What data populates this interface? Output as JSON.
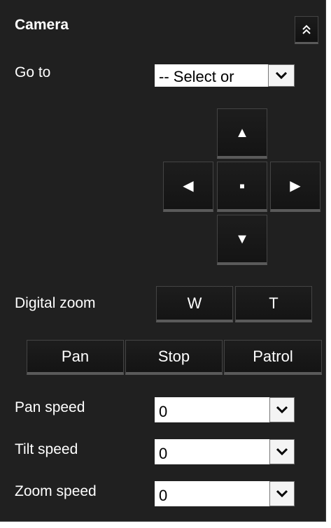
{
  "panel": {
    "title": "Camera",
    "collapse_icon": "double-chevron-up-icon"
  },
  "goto": {
    "label": "Go to",
    "selected": "-- Select or"
  },
  "dpad": {
    "up": "▲",
    "left": "◀",
    "home": "■",
    "right": "▶",
    "down": "▼"
  },
  "digital_zoom": {
    "label": "Digital zoom",
    "wide": "W",
    "tele": "T"
  },
  "actions": {
    "pan": "Pan",
    "stop": "Stop",
    "patrol": "Patrol"
  },
  "pan_speed": {
    "label": "Pan speed",
    "value": "0"
  },
  "tilt_speed": {
    "label": "Tilt speed",
    "value": "0"
  },
  "zoom_speed": {
    "label": "Zoom speed",
    "value": "0"
  }
}
